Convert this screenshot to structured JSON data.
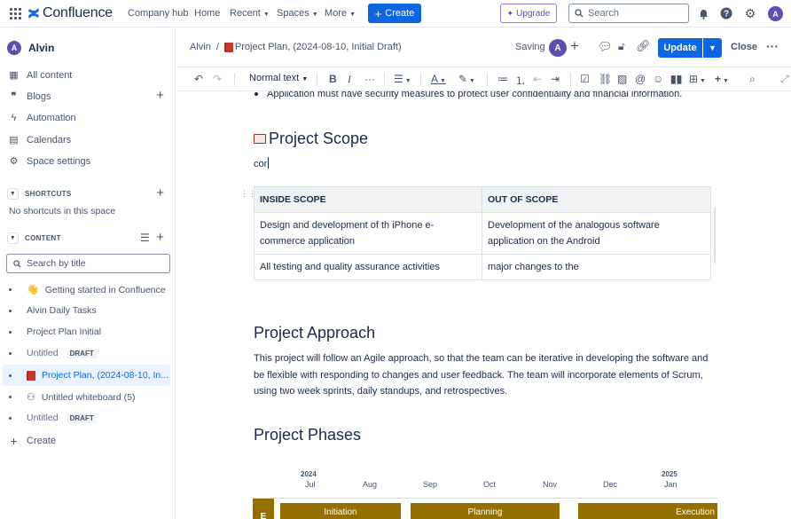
{
  "topnav": {
    "brand": "Confluence",
    "items": [
      "Company hub",
      "Home",
      "Recent",
      "Spaces",
      "More"
    ],
    "create_label": "Create",
    "upgrade_label": "Upgrade",
    "search_placeholder": "Search",
    "user_initial": "A"
  },
  "sidebar": {
    "user_name": "Alvin",
    "user_initial": "A",
    "nav": [
      {
        "label": "All content",
        "icon": "all-content-icon"
      },
      {
        "label": "Blogs",
        "icon": "quote-icon"
      },
      {
        "label": "Automation",
        "icon": "lightning-icon"
      },
      {
        "label": "Calendars",
        "icon": "calendar-icon"
      },
      {
        "label": "Space settings",
        "icon": "gear-icon"
      }
    ],
    "shortcuts_heading": "SHORTCUTS",
    "shortcuts_empty": "No shortcuts in this space",
    "content_heading": "CONTENT",
    "search_placeholder": "Search by title",
    "tree": [
      {
        "label": "Getting started in Confluence",
        "emoji": "👋"
      },
      {
        "label": "Alvin Daily Tasks"
      },
      {
        "label": "Project Plan Initial"
      },
      {
        "label": "Untitled",
        "badge": "DRAFT"
      },
      {
        "label": "Project Plan, (2024-08-10, In..."
      },
      {
        "label": "Untitled whiteboard (5)"
      },
      {
        "label": "Untitled",
        "badge": "DRAFT"
      }
    ],
    "create_label": "Create"
  },
  "editor": {
    "breadcrumb_space": "Alvin",
    "breadcrumb_sep": "/",
    "breadcrumb_page": "Project Plan, (2024-08-10, Initial Draft)",
    "saving": "Saving",
    "avatar_initial": "A",
    "update_label": "Update",
    "close_label": "Close",
    "text_style": "Normal text"
  },
  "doc": {
    "bullet_text": "Application must have security measures to protect user confidentiality and financial information.",
    "scope_heading": "Project Scope",
    "typed_text": "cor",
    "scope_table": {
      "headers": [
        "INSIDE SCOPE",
        "OUT OF SCOPE"
      ],
      "rows": [
        [
          "Design and development of th iPhone e-commerce application",
          "Development of the analogous software application on the Android"
        ],
        [
          "All testing and quality assurance activities",
          "major changes to the"
        ]
      ]
    },
    "approach_heading": "Project Approach",
    "approach_text": "This project will follow an Agile approach, so that the team can be iterative in developing the software and be flexible with responding to changes and user feedback. The team will incorporate elements of Scrum, using two week sprints, daily standups, and retrospectives.",
    "phases_heading": "Project Phases",
    "timeline": {
      "years": [
        "2024",
        "2025"
      ],
      "months": [
        "Jul",
        "Aug",
        "Sep",
        "Oct",
        "Nov",
        "Dec",
        "Jan"
      ],
      "row_label": "E",
      "phases": [
        "Initiation",
        "Planning",
        "Execution"
      ],
      "phase_color": "#946f00"
    }
  },
  "colors": {
    "primary": "#0c66e4",
    "avatar": "#5e4db2",
    "text": "#172b4d",
    "subtle": "#44546f"
  }
}
